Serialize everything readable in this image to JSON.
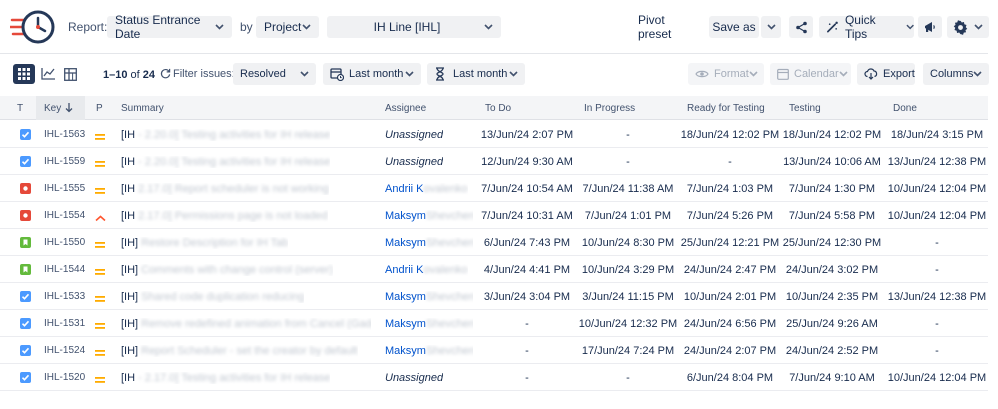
{
  "header": {
    "report_label": "Report:",
    "report_value": "Status Entrance Date",
    "by_label": "by",
    "group_value": "Project",
    "project_value": "IH Line [IHL]",
    "pivot_preset": "Pivot preset",
    "save_as": "Save as",
    "quick_tips": "Quick Tips"
  },
  "toolbar": {
    "range_text": "1–10",
    "of_text": "of",
    "total": "24",
    "filter_label": "Filter issues:",
    "filter_value": "Resolved",
    "date_filter_1": "Last month",
    "date_filter_2": "Last month",
    "format_label": "Format",
    "calendar_label": "Calendar",
    "export_label": "Export",
    "columns_label": "Columns"
  },
  "columns": {
    "type": "T",
    "key": "Key",
    "priority": "P",
    "summary": "Summary",
    "assignee": "Assignee",
    "todo": "To Do",
    "in_progress": "In Progress",
    "ready_for_testing": "Ready for Testing",
    "testing": "Testing",
    "done": "Done"
  },
  "colors": {
    "task": "#4c9aff",
    "bug": "#e5493a",
    "story": "#63ba3c",
    "medium": "#ffab00",
    "high": "#ff5630",
    "link": "#0052cc"
  },
  "rows": [
    {
      "type": "task",
      "key": "IHL-1563",
      "priority": "medium",
      "summary_prefix": "[IH",
      "summary_blur": "- 2.20.0] Testing activities for IH release",
      "assignee": "Unassigned",
      "assignee_blur": "",
      "todo": "13/Jun/24 2:07 PM",
      "in_progress": "-",
      "ready_for_testing": "18/Jun/24 12:02 PM",
      "testing": "18/Jun/24 12:02 PM",
      "done": "18/Jun/24 3:15 PM"
    },
    {
      "type": "task",
      "key": "IHL-1559",
      "priority": "medium",
      "summary_prefix": "[IH",
      "summary_blur": "- 2.20.0] Testing activities for IH release",
      "assignee": "Unassigned",
      "assignee_blur": "",
      "todo": "12/Jun/24 9:30 AM",
      "in_progress": "-",
      "ready_for_testing": "-",
      "testing": "13/Jun/24 10:06 AM",
      "done": "13/Jun/24 12:38 PM"
    },
    {
      "type": "bug",
      "key": "IHL-1555",
      "priority": "medium",
      "summary_prefix": "[IH",
      "summary_blur": "2.17.0] Report scheduler is not working",
      "assignee": "Andrii K",
      "assignee_blur": "ovalenko",
      "todo": "7/Jun/24 10:54 AM",
      "in_progress": "7/Jun/24 11:38 AM",
      "ready_for_testing": "7/Jun/24 1:03 PM",
      "testing": "7/Jun/24 1:30 PM",
      "done": "10/Jun/24 12:04 PM"
    },
    {
      "type": "bug",
      "key": "IHL-1554",
      "priority": "high",
      "summary_prefix": "[IH",
      "summary_blur": "2.17.0] Permissions page is not loaded",
      "assignee": "Maksym",
      "assignee_blur": "Shevchenko",
      "todo": "7/Jun/24 10:31 AM",
      "in_progress": "7/Jun/24 1:01 PM",
      "ready_for_testing": "7/Jun/24 5:26 PM",
      "testing": "7/Jun/24 5:58 PM",
      "done": "10/Jun/24 12:04 PM"
    },
    {
      "type": "story",
      "key": "IHL-1550",
      "priority": "medium",
      "summary_prefix": "[IH]",
      "summary_blur": "Restore Description for IH Tab",
      "assignee": "Maksym",
      "assignee_blur": "Shevchenko",
      "todo": "6/Jun/24 7:43 PM",
      "in_progress": "10/Jun/24 8:30 PM",
      "ready_for_testing": "25/Jun/24 12:21 PM",
      "testing": "25/Jun/24 12:30 PM",
      "done": "-"
    },
    {
      "type": "story",
      "key": "IHL-1544",
      "priority": "medium",
      "summary_prefix": "[IH]",
      "summary_blur": "Comments with change control (server)",
      "assignee": "Andrii K",
      "assignee_blur": "ovalenko",
      "todo": "4/Jun/24 4:41 PM",
      "in_progress": "10/Jun/24 3:29 PM",
      "ready_for_testing": "24/Jun/24 2:47 PM",
      "testing": "24/Jun/24 3:02 PM",
      "done": "-"
    },
    {
      "type": "task",
      "key": "IHL-1533",
      "priority": "medium",
      "summary_prefix": "[IH]",
      "summary_blur": "Shared code duplication reducing",
      "assignee": "Maksym",
      "assignee_blur": "Shevchenko",
      "todo": "3/Jun/24 3:04 PM",
      "in_progress": "3/Jun/24 11:15 PM",
      "ready_for_testing": "10/Jun/24 2:01 PM",
      "testing": "10/Jun/24 2:35 PM",
      "done": "13/Jun/24 12:38 PM"
    },
    {
      "type": "task",
      "key": "IHL-1531",
      "priority": "medium",
      "summary_prefix": "[IH]",
      "summary_blur": "Remove redefined animation from Cancel (Gadget)",
      "assignee": "Maksym",
      "assignee_blur": "Shevchenko",
      "todo": "-",
      "in_progress": "10/Jun/24 12:32 PM",
      "ready_for_testing": "24/Jun/24 6:56 PM",
      "testing": "25/Jun/24 9:26 AM",
      "done": "-"
    },
    {
      "type": "task",
      "key": "IHL-1524",
      "priority": "medium",
      "summary_prefix": "[IH]",
      "summary_blur": "Report Scheduler - set the creator by default",
      "assignee": "Maksym",
      "assignee_blur": "Shevchenko",
      "todo": "-",
      "in_progress": "17/Jun/24 7:24 PM",
      "ready_for_testing": "24/Jun/24 2:07 PM",
      "testing": "24/Jun/24 2:52 PM",
      "done": "-"
    },
    {
      "type": "task",
      "key": "IHL-1520",
      "priority": "medium",
      "summary_prefix": "[IH",
      "summary_blur": "- 2.17.0] Testing activities for IH release",
      "assignee": "Unassigned",
      "assignee_blur": "",
      "todo": "-",
      "in_progress": "-",
      "ready_for_testing": "6/Jun/24 8:04 PM",
      "testing": "7/Jun/24 9:10 AM",
      "done": "10/Jun/24 12:04 PM"
    }
  ]
}
